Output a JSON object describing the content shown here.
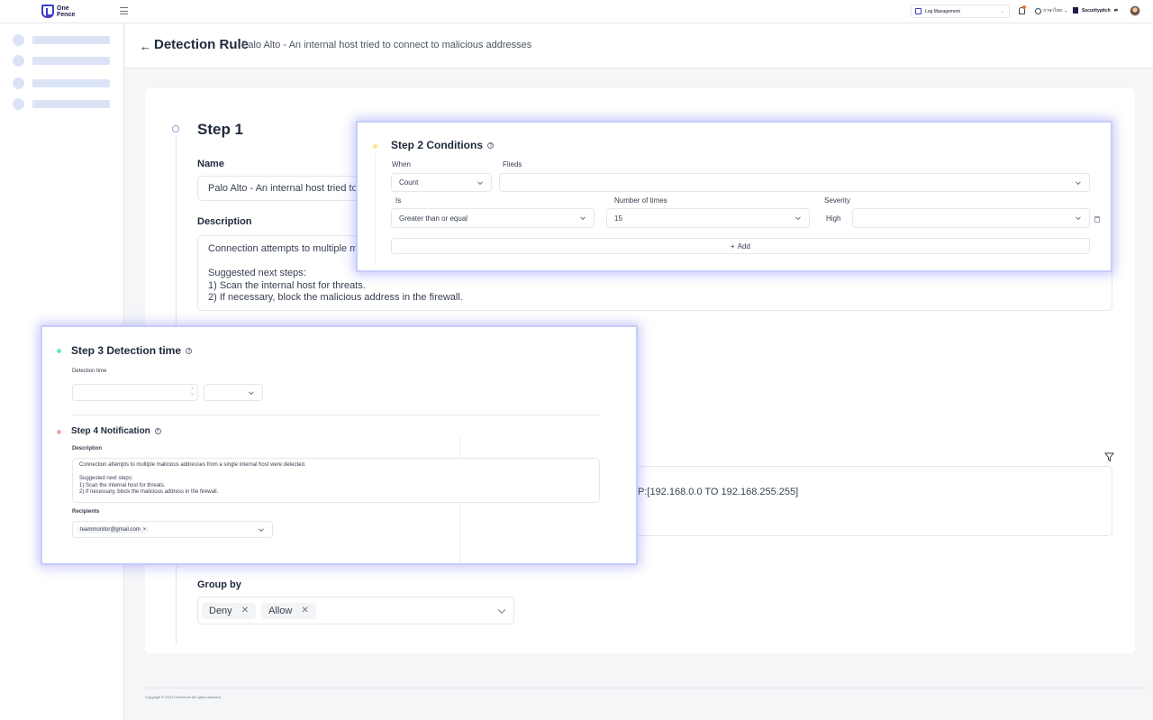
{
  "topbar": {
    "logo_text": "One\nFence",
    "app_select": "Log Management",
    "language": "ภาษาไทย",
    "org_name": "Securitypitch"
  },
  "header": {
    "title": "Detection Rule",
    "subtitle": "Palo Alto - An internal host tried to connect to malicious addresses"
  },
  "step1": {
    "title": "Step 1",
    "name_label": "Name",
    "name_value": "Palo Alto - An internal host tried to",
    "description_label": "Description",
    "description_value": "Connection attempts to multiple m\n\nSuggested next steps:\n1) Scan the internal host for threats.\n2) If necessary, block the malicious address in the firewall.",
    "query_value": "P:[192.168.0.0 TO 192.168.255.255]",
    "group_by_label": "Group by",
    "group_by_tags": [
      "Deny",
      "Allow"
    ]
  },
  "step2": {
    "title": "Step 2 Conditions",
    "when_label": "When",
    "when_value": "Count",
    "fields_label": "Flieds",
    "fields_value": "",
    "is_label": "Is",
    "is_value": "Greater than or equal",
    "times_label": "Number of times",
    "times_value": "15",
    "severity_label": "Severity",
    "severity_value": "High",
    "severity_select": "",
    "add_label": "Add"
  },
  "step3": {
    "title": "Step 3 Detection time",
    "detection_time_label": "Detection time",
    "detection_time_value": "",
    "detection_unit": ""
  },
  "step4": {
    "title": "Step 4 Notification",
    "description_label": "Description",
    "description_value": "Connection attempts to multiple malicious addresses from a single internal host were detected.\n\nSuggested next steps:\n1) Scan the internal host for threats.\n2) If necessary, block the malicious address in the firewall.",
    "recipients_label": "Recipients",
    "recipients": [
      "teammonitor@gmail.com"
    ]
  },
  "footer": {
    "copyright": "Copyright © 2023 OneFence All rights reserved."
  },
  "colors": {
    "brand": "#3b3ec9",
    "panel_glow": "#6366f1",
    "step2_dot": "#fde68a",
    "step3_dot": "#6ee7b7",
    "step4_dot": "#fca5a5"
  }
}
